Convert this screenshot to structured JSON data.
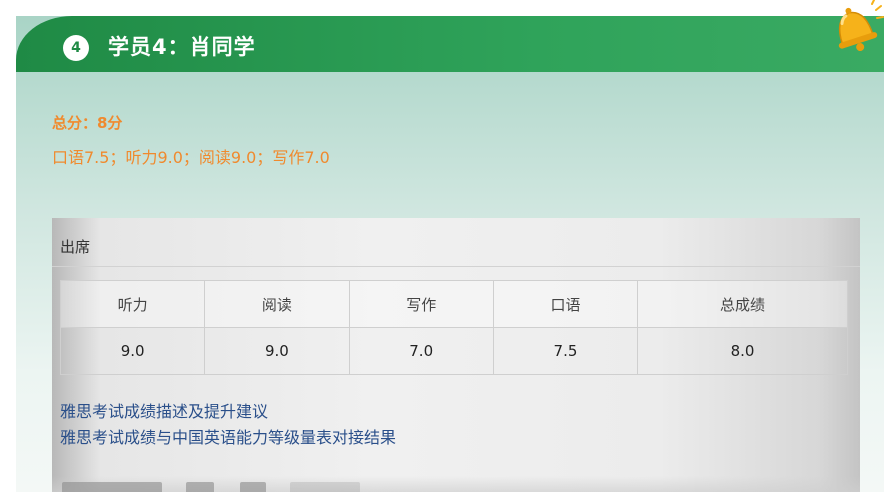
{
  "header": {
    "number": "4",
    "title": "学员4：肖同学"
  },
  "summary": {
    "total": "总分：8分",
    "detail": "口语7.5；听力9.0；阅读9.0；写作7.0"
  },
  "photo": {
    "attendance": "出席",
    "columns": [
      "听力",
      "阅读",
      "写作",
      "口语",
      "总成绩"
    ],
    "scores": [
      "9.0",
      "9.0",
      "7.0",
      "7.5",
      "8.0"
    ],
    "links": [
      "雅思考试成绩描述及提升建议",
      "雅思考试成绩与中国英语能力等级量表对接结果"
    ]
  },
  "colors": {
    "accent_green": "#1f8a45",
    "orange": "#f08a2e",
    "link_blue": "#2a4f8a"
  },
  "icons": {
    "bell": "bell-icon"
  }
}
